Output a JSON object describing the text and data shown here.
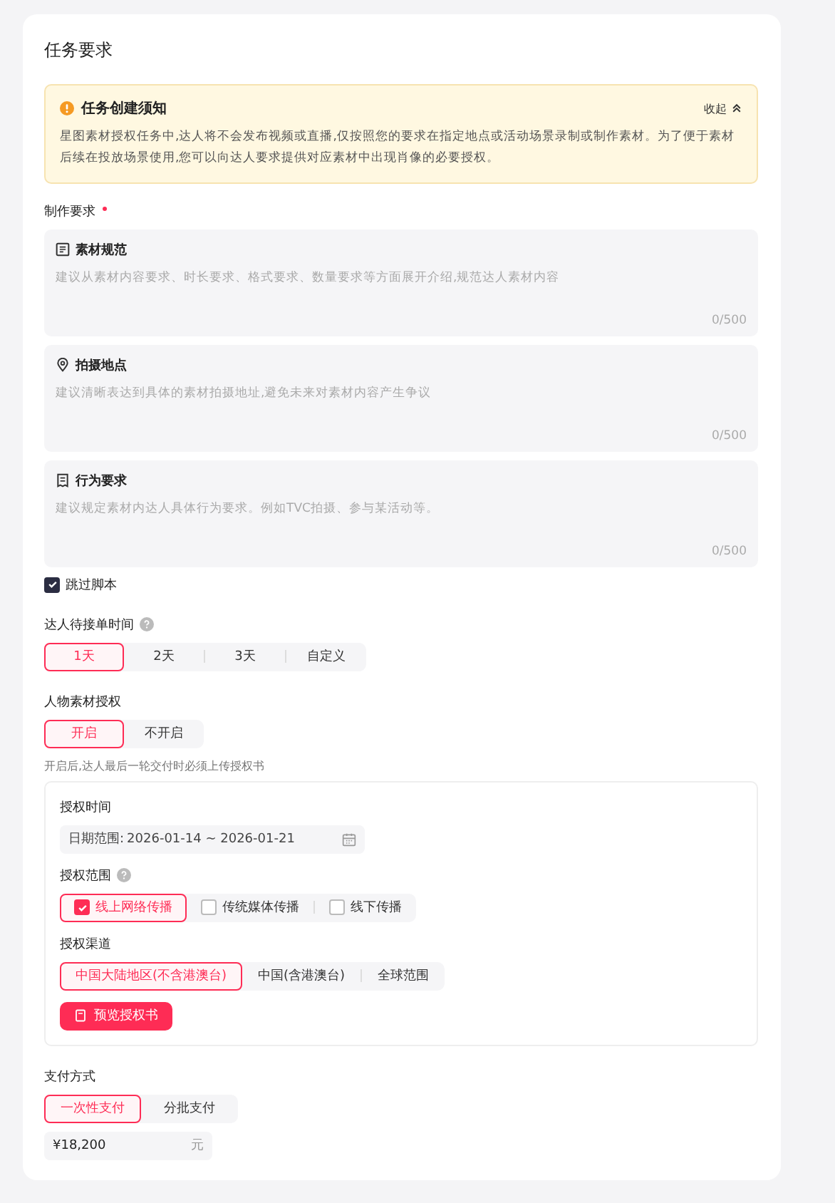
{
  "title": "任务要求",
  "notice": {
    "title": "任务创建须知",
    "toggle": "收起",
    "expanded": true,
    "text": "星图素材授权任务中,达人将不会发布视频或直播,仅按照您的要求在指定地点或活动场景录制或制作素材。为了便于素材后续在投放场景使用,您可以向达人要求提供对应素材中出现肖像的必要授权。"
  },
  "production": {
    "label": "制作要求",
    "required": true,
    "fields": [
      {
        "kind": "doc",
        "title": "素材规范",
        "placeholder": "建议从素材内容要求、时长要求、格式要求、数量要求等方面展开介绍,规范达人素材内容",
        "count": "0/500"
      },
      {
        "kind": "pin",
        "title": "拍摄地点",
        "placeholder": "建议清晰表达到具体的素材拍摄地址,避免未来对素材内容产生争议",
        "count": "0/500"
      },
      {
        "kind": "list",
        "title": "行为要求",
        "placeholder": "建议规定素材内达人具体行为要求。例如TVC拍摄、参与某活动等。",
        "count": "0/500"
      }
    ],
    "skip_script": {
      "label": "跳过脚本",
      "checked": true
    }
  },
  "wait_time": {
    "label": "达人待接单时间",
    "help": true,
    "options": [
      {
        "label": "1天",
        "selected": true
      },
      {
        "label": "2天",
        "selected": false
      },
      {
        "label": "3天",
        "selected": false
      },
      {
        "label": "自定义",
        "selected": false
      }
    ]
  },
  "portrait": {
    "label": "人物素材授权",
    "options": [
      {
        "label": "开启",
        "selected": true
      },
      {
        "label": "不开启",
        "selected": false
      }
    ],
    "hint": "开启后,达人最后一轮交付时必须上传授权书"
  },
  "auth": {
    "time_label": "授权时间",
    "date_prefix": "日期范围:",
    "date_value": "2026-01-14 ~ 2026-01-21",
    "scope_label": "授权范围",
    "scope_help": true,
    "scope": [
      {
        "label": "线上网络传播",
        "checked": true
      },
      {
        "label": "传统媒体传播",
        "checked": false
      },
      {
        "label": "线下传播",
        "checked": false
      }
    ],
    "channel_label": "授权渠道",
    "channels": [
      {
        "label": "中国大陆地区(不含港澳台)",
        "selected": true
      },
      {
        "label": "中国(含港澳台)",
        "selected": false
      },
      {
        "label": "全球范围",
        "selected": false
      }
    ],
    "preview_button": "预览授权书"
  },
  "payment": {
    "label": "支付方式",
    "options": [
      {
        "label": "一次性支付",
        "selected": true
      },
      {
        "label": "分批支付",
        "selected": false
      }
    ],
    "amount": "¥18,200",
    "unit": "元"
  }
}
